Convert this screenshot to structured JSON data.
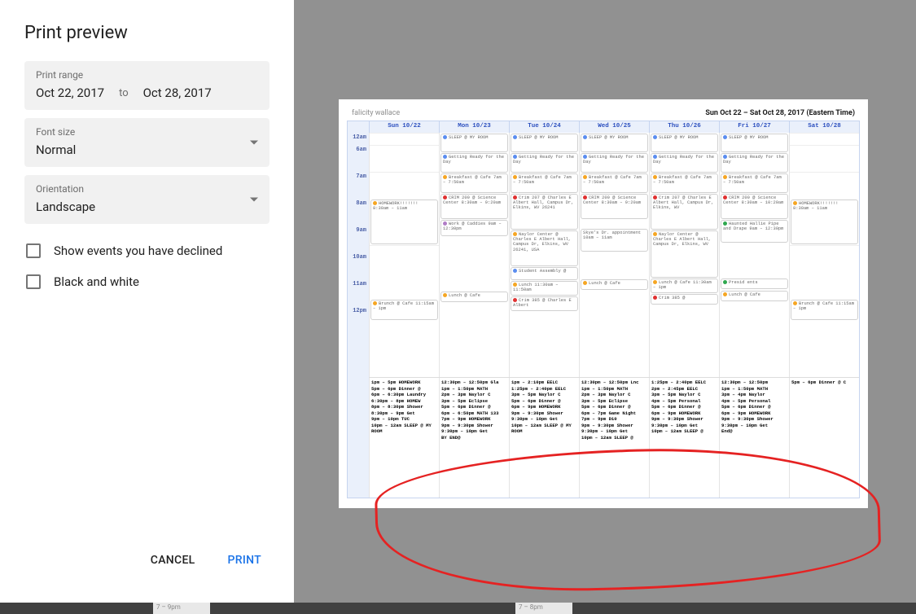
{
  "title": "Print preview",
  "print_range": {
    "label": "Print range",
    "from": "Oct 22, 2017",
    "to_label": "to",
    "to": "Oct 28, 2017"
  },
  "font_size": {
    "label": "Font size",
    "value": "Normal"
  },
  "orientation": {
    "label": "Orientation",
    "value": "Landscape"
  },
  "checkbox1": "Show events you have declined",
  "checkbox2": "Black and white",
  "footer": {
    "cancel": "CANCEL",
    "print": "PRINT"
  },
  "calendar": {
    "user": "falicity wallace",
    "range": "Sun Oct 22 – Sat Oct 28, 2017 (Eastern Time)",
    "days": [
      "Sun 10/22",
      "Mon 10/23",
      "Tue 10/24",
      "Wed 10/25",
      "Thu 10/26",
      "Fri 10/27",
      "Sat 10/28"
    ],
    "hours": [
      "12am",
      "6am",
      "7am",
      "8am",
      "9am",
      "10am",
      "11am",
      "12pm"
    ]
  },
  "events": {
    "mon": {
      "sleep": "SLEEP @ MY ROOM",
      "ready": "Getting Ready for the Day",
      "breakfast": "Breakfast @ Cafe\n7am – 7:50am",
      "crim": "CRIM 200 @ Science Center\n8:30am – 9:20am",
      "work": "Work @ Caddies\n9am – 12:30pm",
      "lunch": "Lunch @ Cafe"
    },
    "tue": {
      "sleep": "SLEEP @ MY ROOM",
      "ready": "Getting Ready for the Day",
      "breakfast": "Breakfast @ Cafe\n7am – 7:50am",
      "crim": "Crim 207 @ Charles E Albert Hall, Campus Dr, Elkins, WV 26241",
      "naylor": "Naylor Center @ Charles E Albert Hall, Campus Dr, Elkins, WV 26241, USA",
      "assembly": "Student Assembly @",
      "lunch": "Lunch\n11:30am – 11:50am",
      "crimpm": "Crim 385 @ Charles E Albert"
    },
    "wed": {
      "sleep": "SLEEP @ MY ROOM",
      "ready": "Getting Ready for the Day",
      "breakfast": "Breakfast @ Cafe\n7am – 7:50am",
      "crim": "CRIM 200 @ Science Center\n8:30am – 9:20am",
      "lunch": "Lunch @ Cafe",
      "skye": "Skye's Dr. appointment\n10am – 11am"
    },
    "thu": {
      "sleep": "SLEEP @ MY ROOM",
      "ready": "Getting Ready for the Day",
      "breakfast": "Breakfast @ Cafe\n7am – 7:50am",
      "crim": "Crim 207 @ Charles E Albert Hall, Campus Dr, Elkins, WV",
      "naylor": "Naylor Center @ Charles E Albert Hall, Campus Dr, Elkins, WV",
      "lunch": "Lunch @ Cafe\n11:30am – 1pm",
      "crimpm": "Crim 385 @"
    },
    "fri": {
      "sleep": "SLEEP @ MY ROOM",
      "ready": "Getting Ready for the Day",
      "breakfast": "Breakfast @ Cafe\n7am – 7:50am",
      "crim": "CRIM 200 @ Science Center\n8:30am – 10:20am",
      "hallie": "Haunted Hallie Pipe and Drape\n9am – 12:30pm",
      "presid": "Presid ents",
      "lunch": "Lunch @ Cafe"
    },
    "sun": {
      "hw": "HOMEWORK!!!!!!!\n8:30am – 11am",
      "brunch": "Brunch @ Cafe\n11:15am – 1pm"
    },
    "sat": {
      "hw": "HOMEWORK!!!!!!!\n8:30am – 11am",
      "brunch": "Brunch @ Cafe\n11:15am – 1pm"
    }
  },
  "afternoon": {
    "sun": "1pm – 5pm  HOMEWORK\n5pm – 6pm  Dinner @\n6pm – 6:30pm  Laundry\n6:30pm – 8pm  HOMEW\n8pm – 8:30pm  Shower\n8:30pm – 9pm  Get\n9pm – 10pm  TUC\n10pm – 12am  SLEEP @ MY ROOM",
    "mon": "12:30pm – 12:50pm  Gla\n1pm – 1:50pm  MATH\n2pm – 3pm  Naylor C\n3pm – 5pm  Eclipse\n5pm – 6pm  Dinner @\n6pm – 6:50pm  MATH 133\n7pm – 9pm  HOMEWORK\n9pm – 9:30pm  Shower\n9:30pm – 10pm  Get\nBY END@",
    "tue": "1pm – 2:10pm  EELC\n1:25pm – 2:40pm  EELC\n3pm – 5pm  Naylor C\n5pm – 6pm  Dinner @\n6pm – 9pm  HOMEWORK\n9pm – 9:30pm  Shower\n9:30pm – 10pm  Get\n10pm – 12am  SLEEP @ MY ROOM",
    "wed": "12:30pm – 12:50pm  Lnc\n1pm – 1:50pm  MATH\n2pm – 3pm  Naylor C\n3pm – 5pm  Eclipse\n5pm – 6pm  Dinner @\n6pm – 7pm  Game Night\n7pm – 9pm  D10\n9pm – 9:30pm  Shower\n9:30pm – 10pm  Get\n10pm – 12am  SLEEP @",
    "thu": "1:25pm – 2:40pm  EELC\n2pm – 2:45pm  EELC\n3pm – 5pm  Naylor C\n4pm – 5pm  Personal\n5pm – 6pm  Dinner @\n6pm – 9pm  HOMEWORK\n9pm – 9:30pm  Shower\n9:30pm – 10pm  Get\n10pm – 12am  SLEEP @",
    "fri": "12:30pm – 12:50pm\n1pm – 1:50pm  MATH\n3pm – 4pm  Naylor\n4pm – 5pm  Personal\n5pm – 6pm  Dinner @\n6pm – 9pm  HOMEWORK\n9pm – 9:30pm  Shower\n9:30pm – 10pm  Get\nEnd@",
    "sat": "5pm – 6pm  Dinner @ C"
  },
  "bottom": {
    "m1": "7 – 9pm",
    "m2": "7 – 8pm"
  }
}
